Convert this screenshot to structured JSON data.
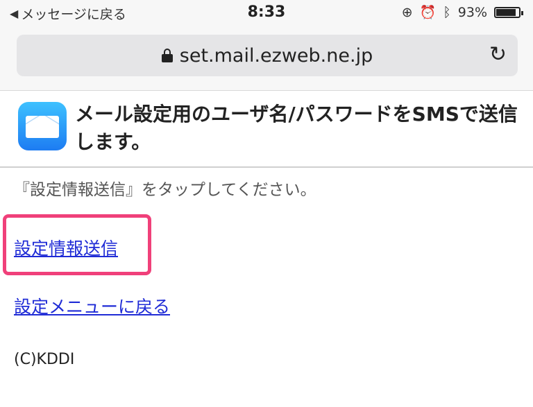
{
  "status_bar": {
    "back_label": "メッセージに戻る",
    "time": "8:33",
    "battery_percent": "93%",
    "battery_level": 0.93,
    "icons": [
      "rotation-lock-icon",
      "alarm-icon",
      "bluetooth-icon",
      "battery-icon"
    ]
  },
  "browser": {
    "url": "set.mail.ezweb.ne.jp",
    "icons": [
      "lock-icon",
      "reload-icon"
    ]
  },
  "header": {
    "title": "メール設定用のユーザ名/パスワードをSMSで送信します。",
    "icon": "mail-app-icon"
  },
  "content": {
    "instruction": "『設定情報送信』をタップしてください。",
    "send_link": "設定情報送信",
    "back_link": "設定メニューに戻る",
    "copyright": "(C)KDDI",
    "highlight_color": "#f0407a",
    "link_color": "#1f2bd6"
  }
}
